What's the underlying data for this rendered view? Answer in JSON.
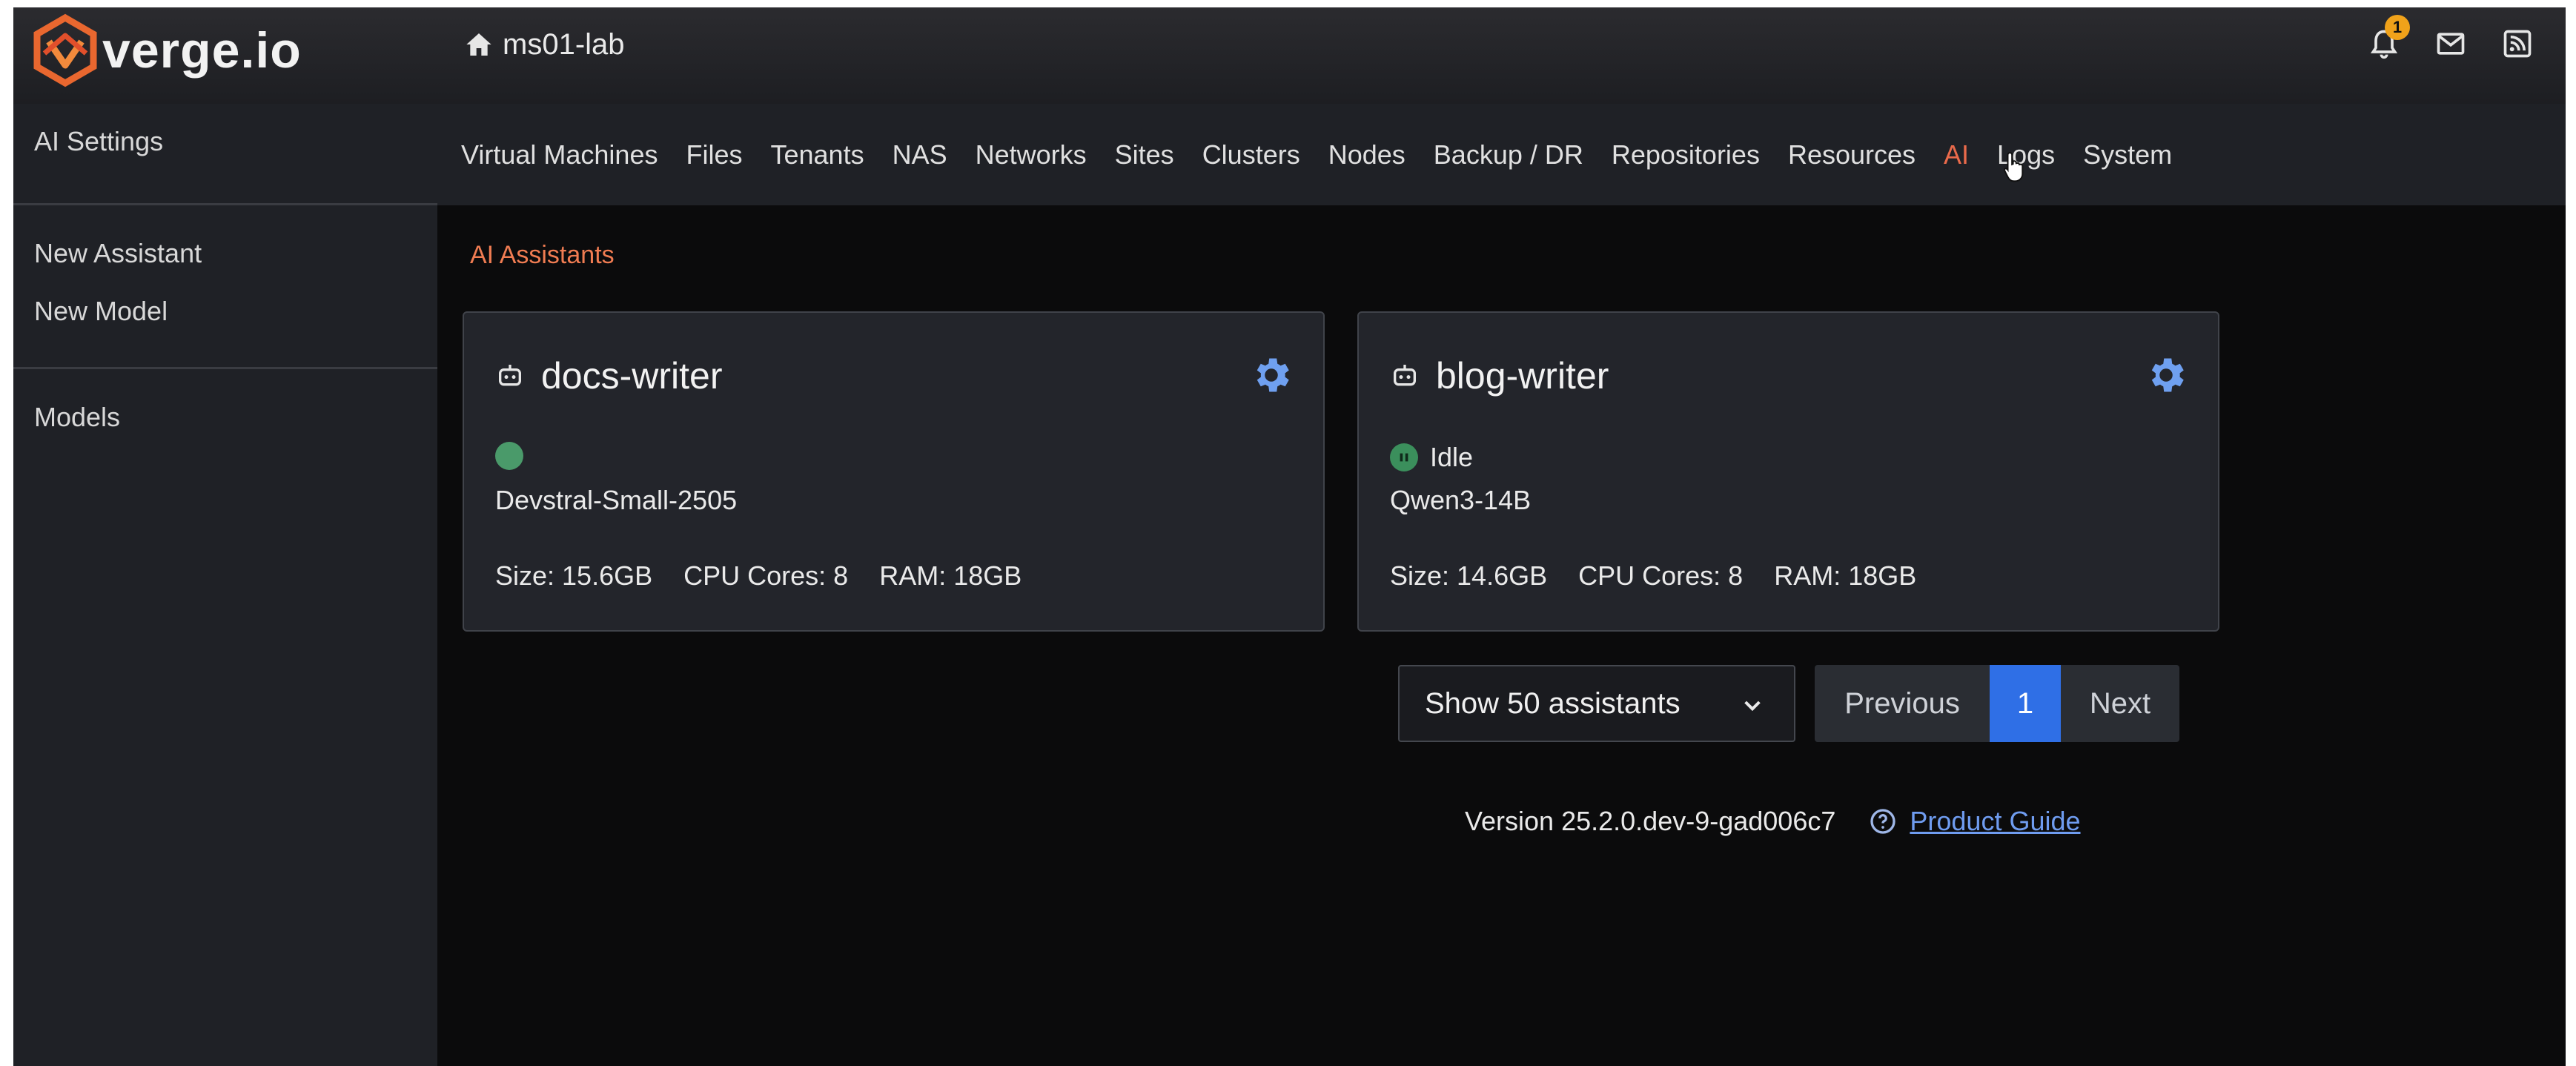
{
  "brand": {
    "logo_text": "verge.io",
    "accent": "#e96a4b"
  },
  "header": {
    "site_name": "ms01-lab",
    "notification_count": "1",
    "icons": [
      "home-icon",
      "bell-icon",
      "mail-icon",
      "feed-icon"
    ]
  },
  "sidebar": {
    "title": "AI Settings",
    "actions": [
      {
        "label": "New Assistant"
      },
      {
        "label": "New Model"
      }
    ],
    "links": [
      {
        "label": "Models"
      }
    ]
  },
  "nav": {
    "items": [
      {
        "label": "Virtual Machines"
      },
      {
        "label": "Files"
      },
      {
        "label": "Tenants"
      },
      {
        "label": "NAS"
      },
      {
        "label": "Networks"
      },
      {
        "label": "Sites"
      },
      {
        "label": "Clusters"
      },
      {
        "label": "Nodes"
      },
      {
        "label": "Backup / DR"
      },
      {
        "label": "Repositories"
      },
      {
        "label": "Resources"
      },
      {
        "label": "AI",
        "active": true
      },
      {
        "label": "Logs"
      },
      {
        "label": "System"
      }
    ]
  },
  "main": {
    "section_title": "AI Assistants",
    "cards": [
      {
        "name": "docs-writer",
        "status": "",
        "model": "Devstral-Small-2505",
        "size": "Size: 15.6GB",
        "cpu": "CPU Cores: 8",
        "ram": "RAM: 18GB"
      },
      {
        "name": "blog-writer",
        "status": "Idle",
        "model": "Qwen3-14B",
        "size": "Size: 14.6GB",
        "cpu": "CPU Cores: 8",
        "ram": "RAM: 18GB"
      }
    ],
    "per_page": "Show 50 assistants",
    "pager": {
      "previous": "Previous",
      "current": "1",
      "next": "Next"
    }
  },
  "footer": {
    "version": "Version 25.2.0.dev-9-gad006c7",
    "guide": "Product Guide"
  }
}
